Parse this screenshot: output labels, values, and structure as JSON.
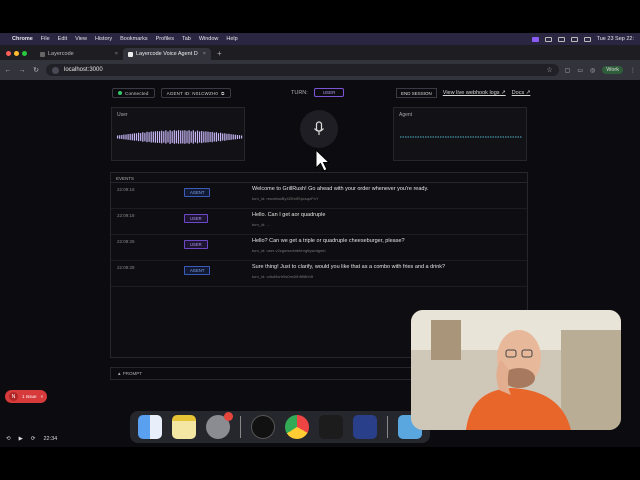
{
  "menubar": {
    "app": "Chrome",
    "items": [
      "File",
      "Edit",
      "View",
      "History",
      "Bookmarks",
      "Profiles",
      "Tab",
      "Window",
      "Help"
    ],
    "clock": "Tue 23 Sep  22:"
  },
  "tabs": [
    {
      "label": "Layercode"
    },
    {
      "label": "Layercode Voice Agent D"
    }
  ],
  "address": {
    "url": "localhost:3000",
    "profile": "Work"
  },
  "status": {
    "connected": "Connected",
    "agent_id": "AGENT ID: N01CWZH0"
  },
  "turn": {
    "label": "TURN:",
    "value": "USER"
  },
  "actions": {
    "end_session": "END SESSION",
    "webhook_logs": "View live webhook logs ↗",
    "docs": "Docs ↗"
  },
  "panels": {
    "user": "User",
    "agent": "Agent"
  },
  "events": {
    "header": "EVENTS",
    "rows": [
      {
        "time": "22:09:18",
        "role": "AGENT",
        "text": "Welcome to GrillRush! Go ahead with your order whenever you're ready.",
        "sub": "turn_id: resvetaoBy42KbIfSpcsqzFnY"
      },
      {
        "time": "22:09:18",
        "role": "USER",
        "text": "Hello. Can I get aor quadruple",
        "sub": "turn_id: ..."
      },
      {
        "time": "22:09:25",
        "role": "USER",
        "text": "Hello? Can we get a triple or quadruple cheeseburger, please?",
        "sub": "turn_id: user-v2zgmsxdmbhhrg6ysedgmb"
      },
      {
        "time": "22:09:28",
        "role": "AGENT",
        "text": "Sure thing! Just to clarify, would you like that as a combo with fries and a drink?",
        "sub": "turn_id: o4sd9crtr9s0m40hft98hhft"
      }
    ]
  },
  "prompt": "▲ PROMPT",
  "issue": {
    "badge": "N",
    "label": "1 Issue",
    "close": "×"
  },
  "video": {
    "time": "22:34"
  },
  "colors": {
    "accent_user": "#7b55d6",
    "accent_agent": "#3a5bb8",
    "connected": "#35c56b",
    "error": "#d63a3a"
  }
}
